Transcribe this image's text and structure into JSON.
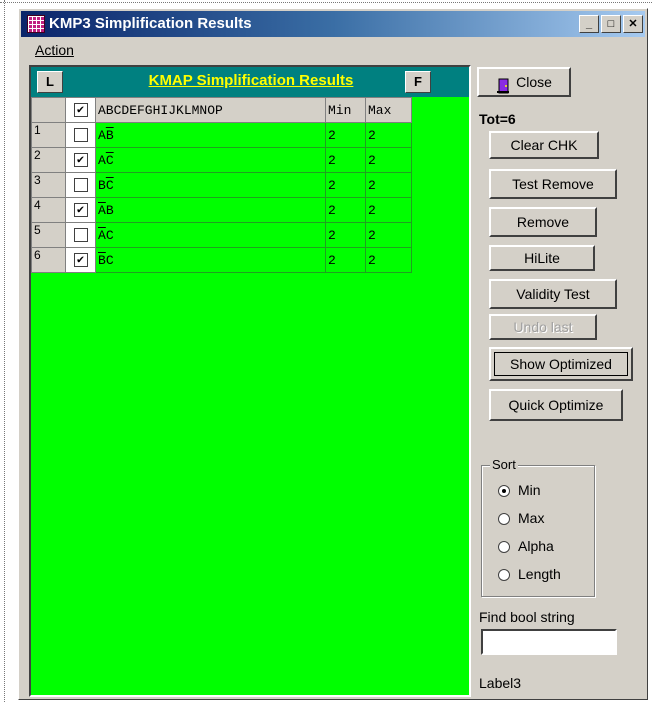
{
  "window": {
    "title": "KMP3 Simplification Results"
  },
  "menu": {
    "action": "Action"
  },
  "panel": {
    "left_button": "L",
    "right_button": "F",
    "title": "KMAP Simplification Results",
    "headers": {
      "checked": "✔",
      "vars": "ABCDEFGHIJKLMNOP",
      "min": "Min",
      "max": "Max"
    },
    "rows": [
      {
        "num": "1",
        "checked": false,
        "t1": "A",
        "t1_bar": false,
        "t2": "B",
        "t2_bar": true,
        "min": "2",
        "max": "2"
      },
      {
        "num": "2",
        "checked": true,
        "t1": "A",
        "t1_bar": false,
        "t2": "C",
        "t2_bar": true,
        "min": "2",
        "max": "2"
      },
      {
        "num": "3",
        "checked": false,
        "t1": "B",
        "t1_bar": false,
        "t2": "C",
        "t2_bar": true,
        "min": "2",
        "max": "2"
      },
      {
        "num": "4",
        "checked": true,
        "t1": "A",
        "t1_bar": true,
        "t2": "B",
        "t2_bar": false,
        "min": "2",
        "max": "2"
      },
      {
        "num": "5",
        "checked": false,
        "t1": "A",
        "t1_bar": true,
        "t2": "C",
        "t2_bar": false,
        "min": "2",
        "max": "2"
      },
      {
        "num": "6",
        "checked": true,
        "t1": "B",
        "t1_bar": true,
        "t2": "C",
        "t2_bar": false,
        "min": "2",
        "max": "2"
      }
    ]
  },
  "side": {
    "close": "Close",
    "total": "Tot=6",
    "clear_chk": "Clear CHK",
    "test_remove": "Test Remove",
    "remove": "Remove",
    "hilite": "HiLite",
    "validity_test": "Validity Test",
    "undo_last": "Undo last",
    "show_optimized": "Show Optimized",
    "quick_optimize": "Quick Optimize"
  },
  "sort": {
    "legend": "Sort",
    "selected": "Min",
    "options": [
      "Min",
      "Max",
      "Alpha",
      "Length"
    ]
  },
  "find": {
    "label": "Find bool string",
    "value": ""
  },
  "status": {
    "label3": "Label3"
  },
  "colors": {
    "grid_bg": "#00ff00",
    "header_bg": "#008080",
    "header_title": "#ffff00",
    "titlebar": "#0a246a"
  }
}
